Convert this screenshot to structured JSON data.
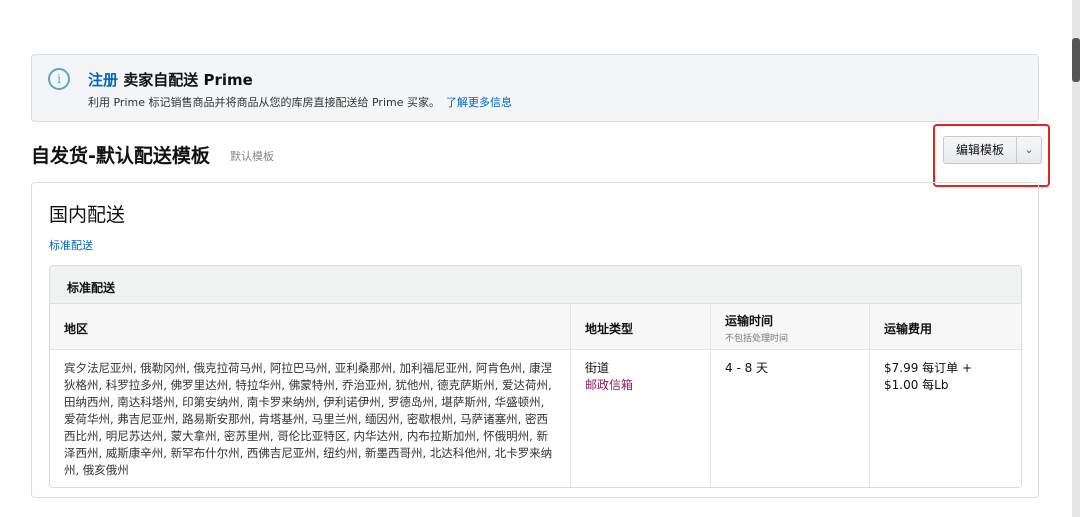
{
  "banner": {
    "link": "注册",
    "title": "卖家自配送 Prime",
    "desc": "利用 Prime 标记销售商品并将商品从您的库房直接配送给 Prime 买家。",
    "more": "了解更多信息",
    "icon": "info-icon"
  },
  "header": {
    "title": "自发货-默认配送模板",
    "subtitle": "默认模板",
    "edit_button": "编辑模板",
    "dropdown": "⌄"
  },
  "section": {
    "title": "国内配送",
    "link": "标准配送",
    "table_title": "标准配送",
    "columns": {
      "region": "地区",
      "address_type": "地址类型",
      "transit_time": "运输时间",
      "transit_note": "不包括处理时间",
      "fee": "运输费用"
    },
    "row": {
      "region": "宾夕法尼亚州, 俄勒冈州, 俄克拉荷马州, 阿拉巴马州, 亚利桑那州, 加利福尼亚州, 阿肯色州, 康涅狄格州, 科罗拉多州, 佛罗里达州, 特拉华州, 佛蒙特州, 乔治亚州, 犹他州, 德克萨斯州, 爱达荷州, 田纳西州, 南达科塔州, 印第安纳州, 南卡罗来纳州, 伊利诺伊州, 罗德岛州, 堪萨斯州, 华盛顿州, 爱荷华州, 弗吉尼亚州, 路易斯安那州, 肯塔基州, 马里兰州, 缅因州, 密歇根州, 马萨诸塞州, 密西西比州, 明尼苏达州, 蒙大拿州, 密苏里州, 哥伦比亚特区, 内华达州, 内布拉斯加州, 怀俄明州, 新泽西州, 威斯康辛州, 新罕布什尔州, 西佛吉尼亚州, 纽约州, 新墨西哥州, 北达科他州, 北卡罗来纳州, 俄亥俄州",
      "address_street": "街道",
      "address_po": "邮政信箱",
      "time": "4 - 8 天",
      "fee_line1": "$7.99 每订单 +",
      "fee_line2": "$1.00 每Lb"
    }
  }
}
